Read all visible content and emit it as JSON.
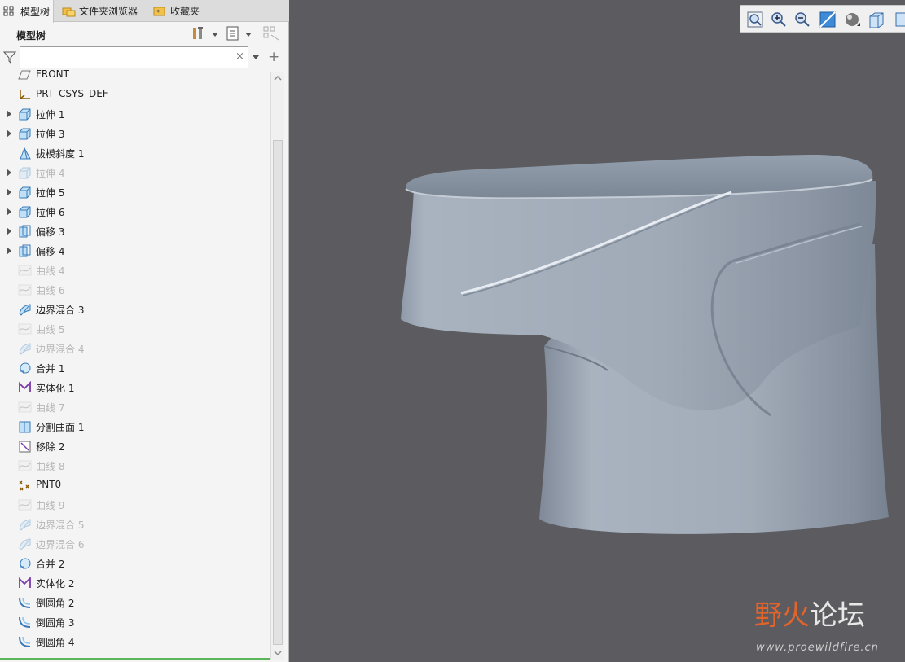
{
  "tabs": [
    {
      "label": "模型树"
    },
    {
      "label": "文件夹浏览器"
    },
    {
      "label": "收藏夹"
    }
  ],
  "tree_header": {
    "title": "模型树"
  },
  "search": {
    "placeholder": "",
    "value": ""
  },
  "tree_items": [
    {
      "label": "FRONT",
      "icon": "datum-plane-icon",
      "expandable": false,
      "dimmed": false
    },
    {
      "label": "PRT_CSYS_DEF",
      "icon": "csys-icon",
      "expandable": false,
      "dimmed": false
    },
    {
      "label": "拉伸 1",
      "icon": "extrude-icon",
      "expandable": true,
      "dimmed": false
    },
    {
      "label": "拉伸 3",
      "icon": "extrude-icon",
      "expandable": true,
      "dimmed": false
    },
    {
      "label": "拔模斜度 1",
      "icon": "draft-icon",
      "expandable": false,
      "dimmed": false
    },
    {
      "label": "拉伸 4",
      "icon": "extrude-icon",
      "expandable": true,
      "dimmed": true
    },
    {
      "label": "拉伸 5",
      "icon": "extrude-icon",
      "expandable": true,
      "dimmed": false
    },
    {
      "label": "拉伸 6",
      "icon": "extrude-icon",
      "expandable": true,
      "dimmed": false
    },
    {
      "label": "偏移 3",
      "icon": "offset-icon",
      "expandable": true,
      "dimmed": false
    },
    {
      "label": "偏移 4",
      "icon": "offset-icon",
      "expandable": true,
      "dimmed": false
    },
    {
      "label": "曲线 4",
      "icon": "curve-icon",
      "expandable": false,
      "dimmed": true
    },
    {
      "label": "曲线 6",
      "icon": "curve-icon",
      "expandable": false,
      "dimmed": true
    },
    {
      "label": "边界混合 3",
      "icon": "boundary-blend-icon",
      "expandable": false,
      "dimmed": false
    },
    {
      "label": "曲线 5",
      "icon": "curve-icon",
      "expandable": false,
      "dimmed": true
    },
    {
      "label": "边界混合 4",
      "icon": "boundary-blend-icon",
      "expandable": false,
      "dimmed": true
    },
    {
      "label": "合并 1",
      "icon": "merge-icon",
      "expandable": false,
      "dimmed": false
    },
    {
      "label": "实体化 1",
      "icon": "solidify-icon",
      "expandable": false,
      "dimmed": false
    },
    {
      "label": "曲线 7",
      "icon": "curve-icon",
      "expandable": false,
      "dimmed": true
    },
    {
      "label": "分割曲面 1",
      "icon": "split-surface-icon",
      "expandable": false,
      "dimmed": false
    },
    {
      "label": "移除 2",
      "icon": "remove-icon",
      "expandable": false,
      "dimmed": false
    },
    {
      "label": "曲线 8",
      "icon": "curve-icon",
      "expandable": false,
      "dimmed": true
    },
    {
      "label": "PNT0",
      "icon": "datum-point-icon",
      "expandable": false,
      "dimmed": false
    },
    {
      "label": "曲线 9",
      "icon": "curve-icon",
      "expandable": false,
      "dimmed": true
    },
    {
      "label": "边界混合 5",
      "icon": "boundary-blend-icon",
      "expandable": false,
      "dimmed": true
    },
    {
      "label": "边界混合 6",
      "icon": "boundary-blend-icon",
      "expandable": false,
      "dimmed": true
    },
    {
      "label": "合并 2",
      "icon": "merge-icon",
      "expandable": false,
      "dimmed": false
    },
    {
      "label": "实体化 2",
      "icon": "solidify-icon",
      "expandable": false,
      "dimmed": false
    },
    {
      "label": "倒圆角 2",
      "icon": "round-icon",
      "expandable": false,
      "dimmed": false
    },
    {
      "label": "倒圆角 3",
      "icon": "round-icon",
      "expandable": false,
      "dimmed": false
    },
    {
      "label": "倒圆角 4",
      "icon": "round-icon",
      "expandable": false,
      "dimmed": false
    }
  ],
  "view_toolbar": [
    "refit-icon",
    "zoom-in-icon",
    "zoom-out-icon",
    "repaint-icon",
    "display-style-icon",
    "saved-views-icon",
    "view-manager-icon"
  ],
  "watermark": {
    "title_part1": "野火",
    "title_part2": "论坛",
    "url": "www.proewildfire.cn"
  },
  "colors": {
    "viewport_bg": "#5b5b60",
    "model": "#a3adba",
    "accent": "#e2642a"
  }
}
